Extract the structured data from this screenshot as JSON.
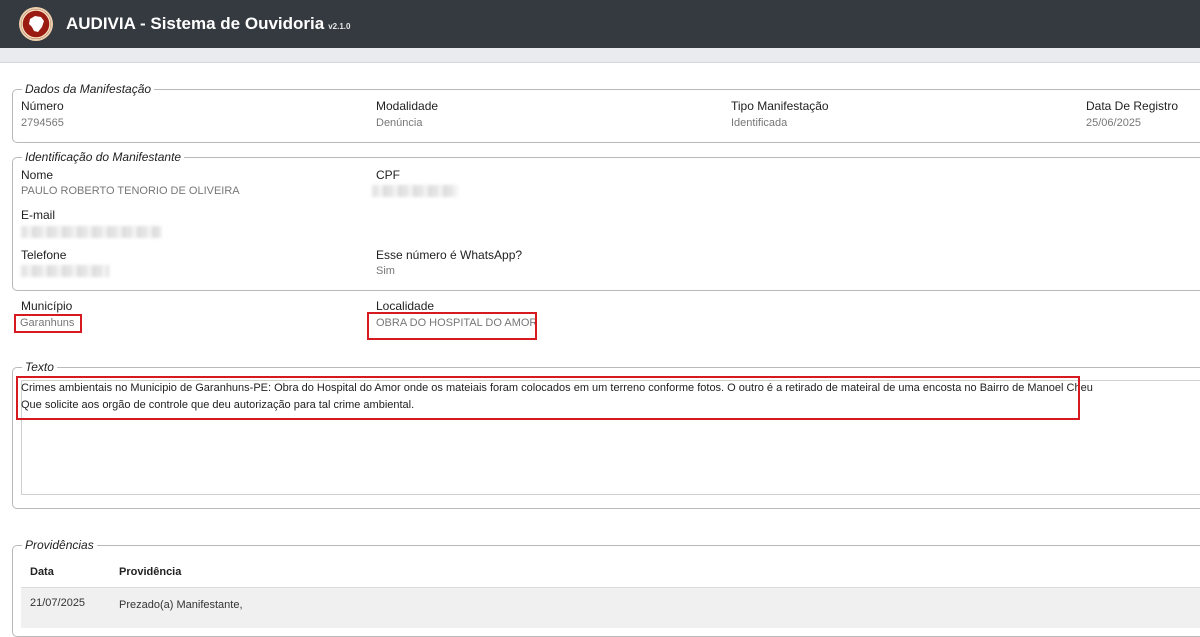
{
  "header": {
    "title": "AUDIVIA - Sistema de Ouvidoria",
    "version": "v2.1.0",
    "logo_icon": "brazil-map-logo-icon",
    "bg_color": "#343a40"
  },
  "dados_manifestacao": {
    "legend": "Dados da Manifestação",
    "fields": [
      {
        "label": "Número",
        "value": "2794565"
      },
      {
        "label": "Modalidade",
        "value": "Denúncia"
      },
      {
        "label": "Tipo Manifestação",
        "value": "Identificada"
      },
      {
        "label": "Data De Registro",
        "value": "25/06/2025"
      }
    ]
  },
  "identificacao": {
    "legend": "Identificação do Manifestante",
    "nome_label": "Nome",
    "nome_value": "PAULO ROBERTO TENORIO DE OLIVEIRA",
    "cpf_label": "CPF",
    "email_label": "E-mail",
    "telefone_label": "Telefone",
    "whatsapp_label": "Esse número é WhatsApp?",
    "whatsapp_value": "Sim"
  },
  "local": {
    "municipio_label": "Município",
    "municipio_value": "Garanhuns",
    "localidade_label": "Localidade",
    "localidade_value": "OBRA DO HOSPITAL DO AMOR"
  },
  "texto": {
    "legend": "Texto",
    "line1": "Crimes ambientais no Municipio de Garanhuns-PE: Obra do Hospital do Amor onde os mateiais foram colocados em um terreno conforme fotos. O outro é a retirado de mateiral de uma encosta no Bairro de Manoel Cheu",
    "line2": "Que solicite aos orgão de controle que deu autorização para tal crime ambiental."
  },
  "providencias": {
    "legend": "Providências",
    "columns": [
      "Data",
      "Providência"
    ],
    "rows": [
      {
        "data": "21/07/2025",
        "providencia": "Prezado(a) Manifestante,"
      }
    ]
  },
  "colors": {
    "highlight": "#d71920"
  }
}
